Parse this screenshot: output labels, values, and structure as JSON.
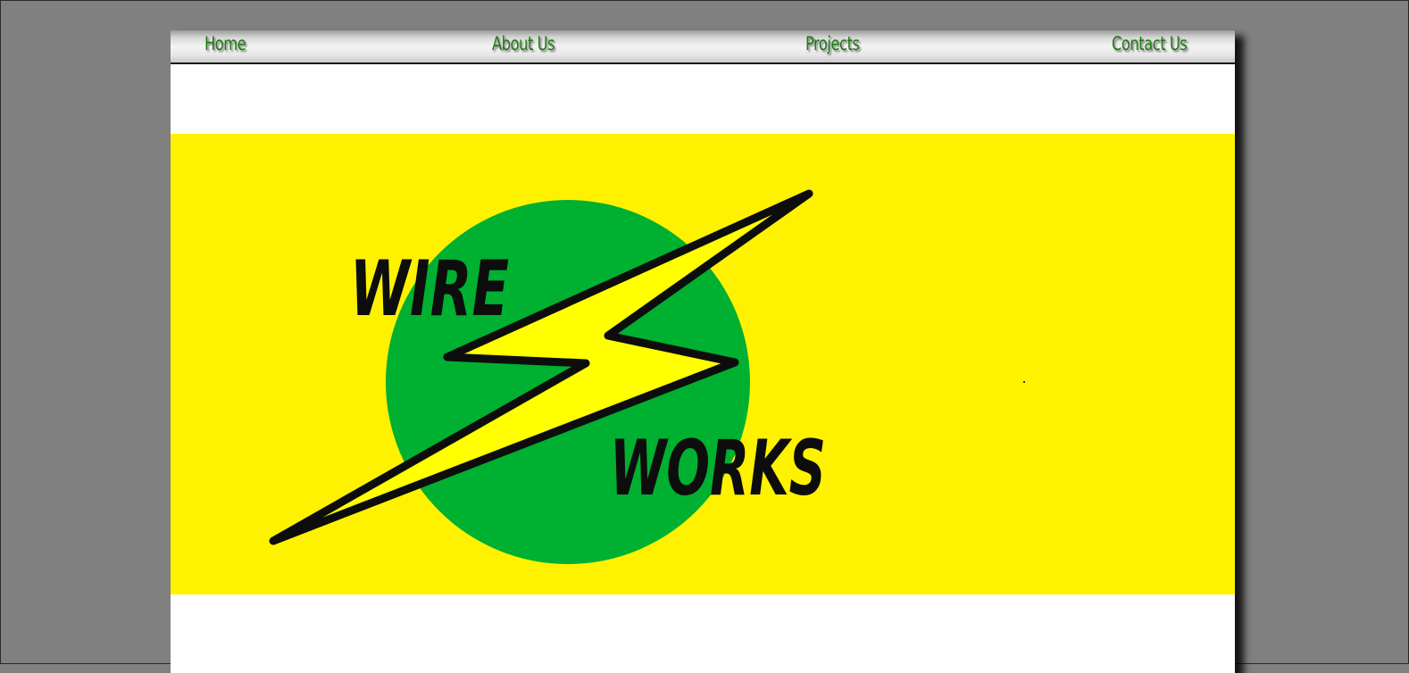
{
  "nav": {
    "items": [
      {
        "label": "Home"
      },
      {
        "label": "About Us"
      },
      {
        "label": "Projects"
      },
      {
        "label": "Contact Us"
      }
    ]
  },
  "banner": {
    "logo": {
      "word_top": "WIRE",
      "word_bottom": "WORKS",
      "icon": "lightning-bolt-icon"
    }
  },
  "colors": {
    "page_background": "#808080",
    "banner_yellow": "#fff200",
    "circle_green": "#00b031",
    "nav_link_green": "#1f7a12",
    "bolt_yellow": "#ffff00"
  }
}
